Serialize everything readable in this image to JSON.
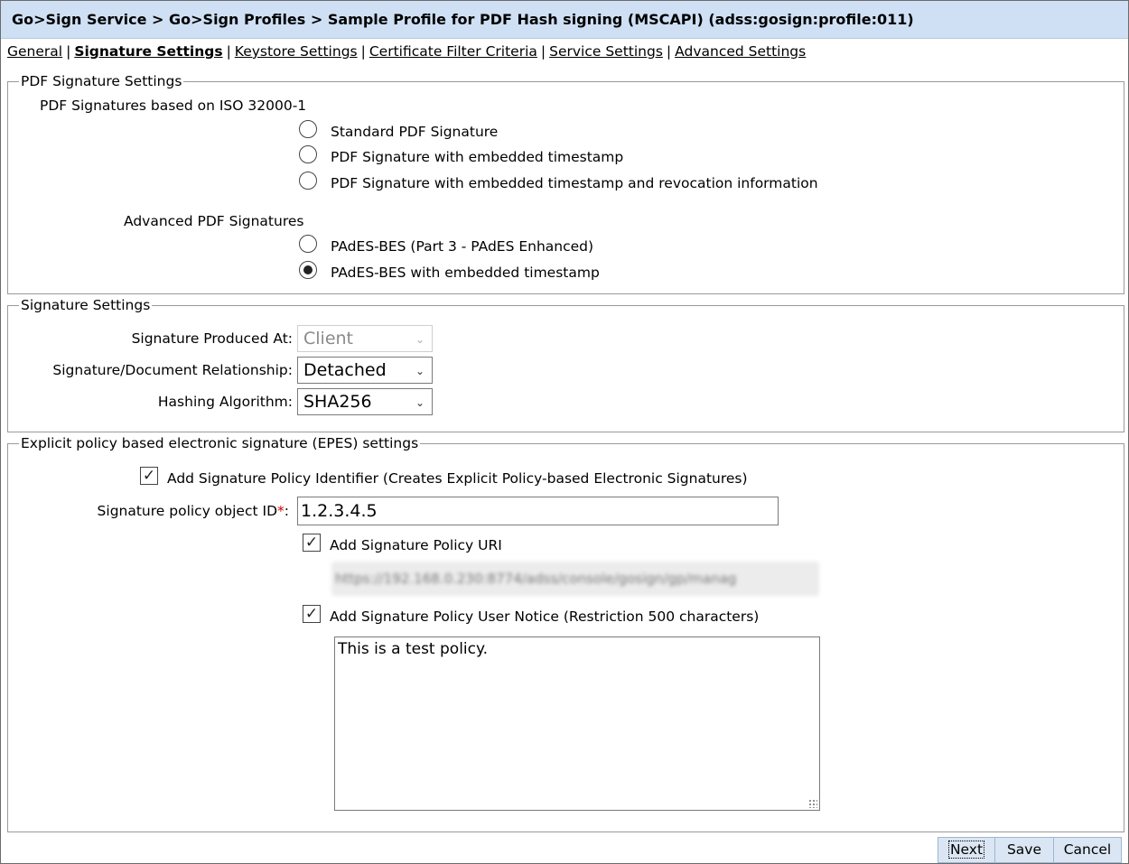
{
  "breadcrumb": "Go>Sign Service > Go>Sign Profiles > Sample Profile for PDF Hash signing (MSCAPI) (adss:gosign:profile:011)",
  "tabs": [
    {
      "label": "General",
      "active": false
    },
    {
      "label": "Signature Settings",
      "active": true
    },
    {
      "label": "Keystore Settings",
      "active": false
    },
    {
      "label": "Certificate Filter Criteria",
      "active": false
    },
    {
      "label": "Service Settings",
      "active": false
    },
    {
      "label": "Advanced Settings",
      "active": false
    }
  ],
  "tab_separator": "|",
  "pdf_section": {
    "legend": "PDF Signature Settings",
    "iso_label": "PDF Signatures based on ISO 32000-1",
    "iso_options": [
      {
        "label": "Standard PDF Signature",
        "selected": false
      },
      {
        "label": "PDF Signature with embedded timestamp",
        "selected": false
      },
      {
        "label": "PDF Signature with embedded timestamp and revocation information",
        "selected": false
      }
    ],
    "advanced_label": "Advanced PDF Signatures",
    "advanced_options": [
      {
        "label": "PAdES-BES (Part 3 - PAdES Enhanced)",
        "selected": false
      },
      {
        "label": "PAdES-BES with embedded timestamp",
        "selected": true
      }
    ]
  },
  "sig_section": {
    "legend": "Signature Settings",
    "produced_at_label": "Signature Produced At:",
    "produced_at_value": "Client",
    "relationship_label": "Signature/Document Relationship:",
    "relationship_value": "Detached",
    "hashing_label": "Hashing Algorithm:",
    "hashing_value": "SHA256"
  },
  "epes_section": {
    "legend": "Explicit policy based electronic signature (EPES) settings",
    "add_identifier_label": "Add Signature Policy Identifier (Creates Explicit Policy-based Electronic Signatures)",
    "add_identifier_checked": true,
    "oid_label": "Signature policy object ID",
    "required_marker": "*",
    "oid_colon": ":",
    "oid_value": "1.2.3.4.5",
    "add_uri_label": "Add Signature Policy URI",
    "add_uri_checked": true,
    "uri_value": "https://192.168.0.230:8774/adss/console/gosign/gp/manag",
    "add_notice_label": "Add Signature Policy User Notice (Restriction 500 characters)",
    "add_notice_checked": true,
    "notice_value": "This is a test policy."
  },
  "buttons": {
    "next": "Next",
    "save": "Save",
    "cancel": "Cancel"
  },
  "icons": {
    "check": "✓",
    "chevron": "⌄"
  }
}
